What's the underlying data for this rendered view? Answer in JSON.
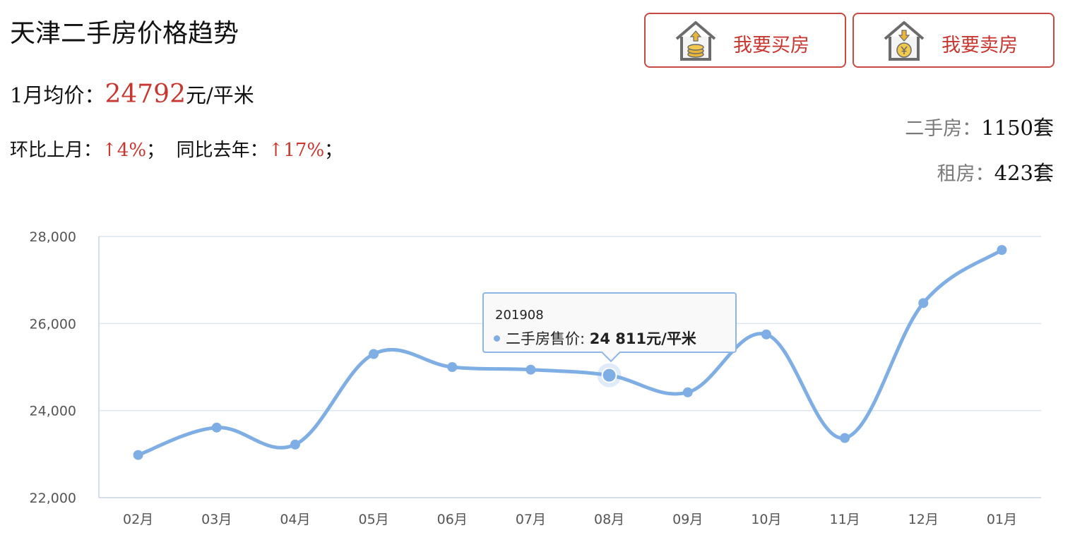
{
  "header": {
    "title": "天津二手房价格趋势",
    "avg_label": "1月均价：",
    "avg_value": "24792",
    "avg_unit": "元/平米",
    "mom_label": "环比上月：",
    "mom_value": "↑4%",
    "yoy_label": "；  同比去年：",
    "yoy_value": "↑17%",
    "yoy_end": "；"
  },
  "buttons": {
    "buy_label": "我要买房",
    "buy_icon": "house-coins-icon",
    "sell_label": "我要卖房",
    "sell_icon": "house-yuan-icon"
  },
  "stats": {
    "sale_label": "二手房：",
    "sale_value": "1150套",
    "rent_label": "租房：",
    "rent_value": "423套"
  },
  "colors": {
    "accent_red": "#c8372f",
    "button_border": "#c64a42",
    "line": "#7eaee3",
    "grid": "#dde5ef"
  },
  "tooltip": {
    "header": "201908",
    "series_label": "二手房售价: ",
    "value_text": "24 811元/平米"
  },
  "chart_data": {
    "type": "line",
    "categories": [
      "02月",
      "03月",
      "04月",
      "05月",
      "06月",
      "07月",
      "08月",
      "09月",
      "10月",
      "11月",
      "12月",
      "01月"
    ],
    "series": [
      {
        "name": "二手房售价",
        "values": [
          22980,
          23610,
          23220,
          25300,
          25000,
          24940,
          24811,
          24420,
          25750,
          23370,
          26470,
          27690
        ]
      }
    ],
    "yticks": [
      "22,000",
      "24,000",
      "26,000",
      "28,000"
    ],
    "ylim": [
      22000,
      28000
    ],
    "highlighted_index": 6,
    "grid": true,
    "legend": "none"
  }
}
